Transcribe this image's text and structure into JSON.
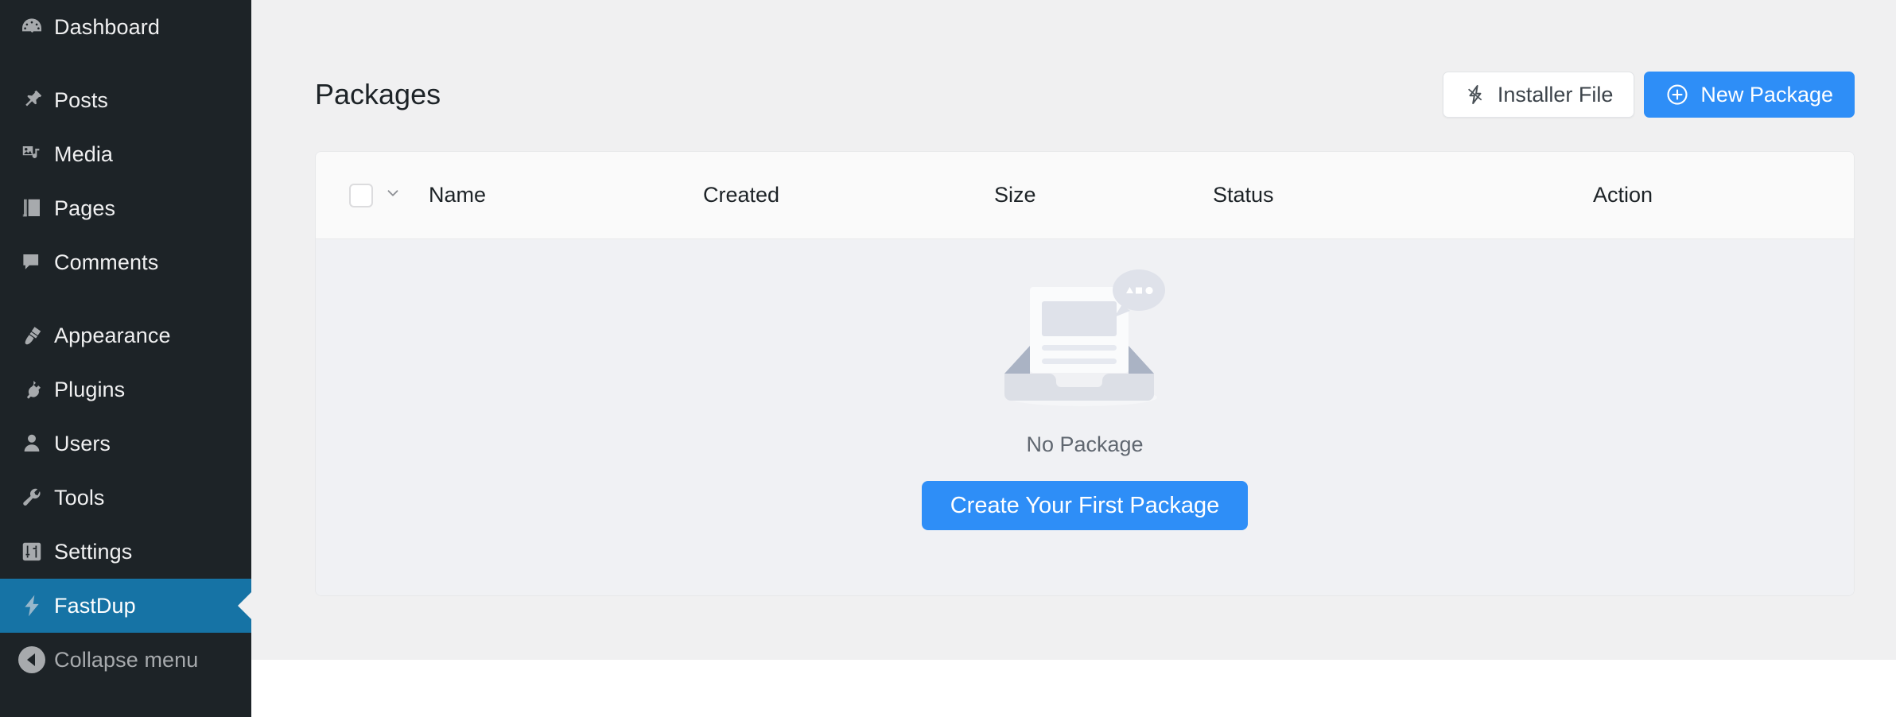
{
  "sidebar": {
    "items": [
      {
        "label": "Dashboard",
        "icon": "dashboard-gauge-icon",
        "name": "dashboard",
        "active": false,
        "gap_after": true
      },
      {
        "label": "Posts",
        "icon": "pin-icon",
        "name": "posts",
        "active": false,
        "gap_after": false
      },
      {
        "label": "Media",
        "icon": "media-icon",
        "name": "media",
        "active": false,
        "gap_after": false
      },
      {
        "label": "Pages",
        "icon": "pages-icon",
        "name": "pages",
        "active": false,
        "gap_after": false
      },
      {
        "label": "Comments",
        "icon": "comment-bubble-icon",
        "name": "comments",
        "active": false,
        "gap_after": true
      },
      {
        "label": "Appearance",
        "icon": "paintbrush-icon",
        "name": "appearance",
        "active": false,
        "gap_after": false
      },
      {
        "label": "Plugins",
        "icon": "plug-icon",
        "name": "plugins",
        "active": false,
        "gap_after": false
      },
      {
        "label": "Users",
        "icon": "user-icon",
        "name": "users",
        "active": false,
        "gap_after": false
      },
      {
        "label": "Tools",
        "icon": "wrench-icon",
        "name": "tools",
        "active": false,
        "gap_after": false
      },
      {
        "label": "Settings",
        "icon": "sliders-icon",
        "name": "settings",
        "active": false,
        "gap_after": false
      },
      {
        "label": "FastDup",
        "icon": "lightning-bolt-icon",
        "name": "fastdup",
        "active": true,
        "gap_after": false
      }
    ],
    "collapse": {
      "label": "Collapse menu",
      "icon": "collapse-arrow-icon"
    },
    "active_color": "#1673a5",
    "background_color": "#1d2327",
    "text_color": "#f0f0f1"
  },
  "header": {
    "title": "Packages",
    "installer_file_button": {
      "label": "Installer File",
      "icon": "lightning-bolt-icon"
    },
    "new_package_button": {
      "label": "New Package",
      "icon": "plus-circle-icon"
    }
  },
  "table": {
    "columns": [
      {
        "key": "name",
        "label": "Name"
      },
      {
        "key": "created",
        "label": "Created"
      },
      {
        "key": "size",
        "label": "Size"
      },
      {
        "key": "status",
        "label": "Status"
      },
      {
        "key": "action",
        "label": "Action"
      }
    ],
    "select_all_checked": false,
    "bulk_chevron_icon": "chevron-down-icon",
    "rows": []
  },
  "empty_state": {
    "illustration": "empty-inbox-icon",
    "message": "No Package",
    "cta_label": "Create Your First Package"
  },
  "colors": {
    "accent_blue": "#2e8ef7",
    "sidebar_active": "#1673a5",
    "content_bg": "#f0f0f1",
    "card_bg": "#f9f9f9",
    "table_body_bg": "#f0f1f4",
    "illustration_gray": "#dcdfe6"
  }
}
